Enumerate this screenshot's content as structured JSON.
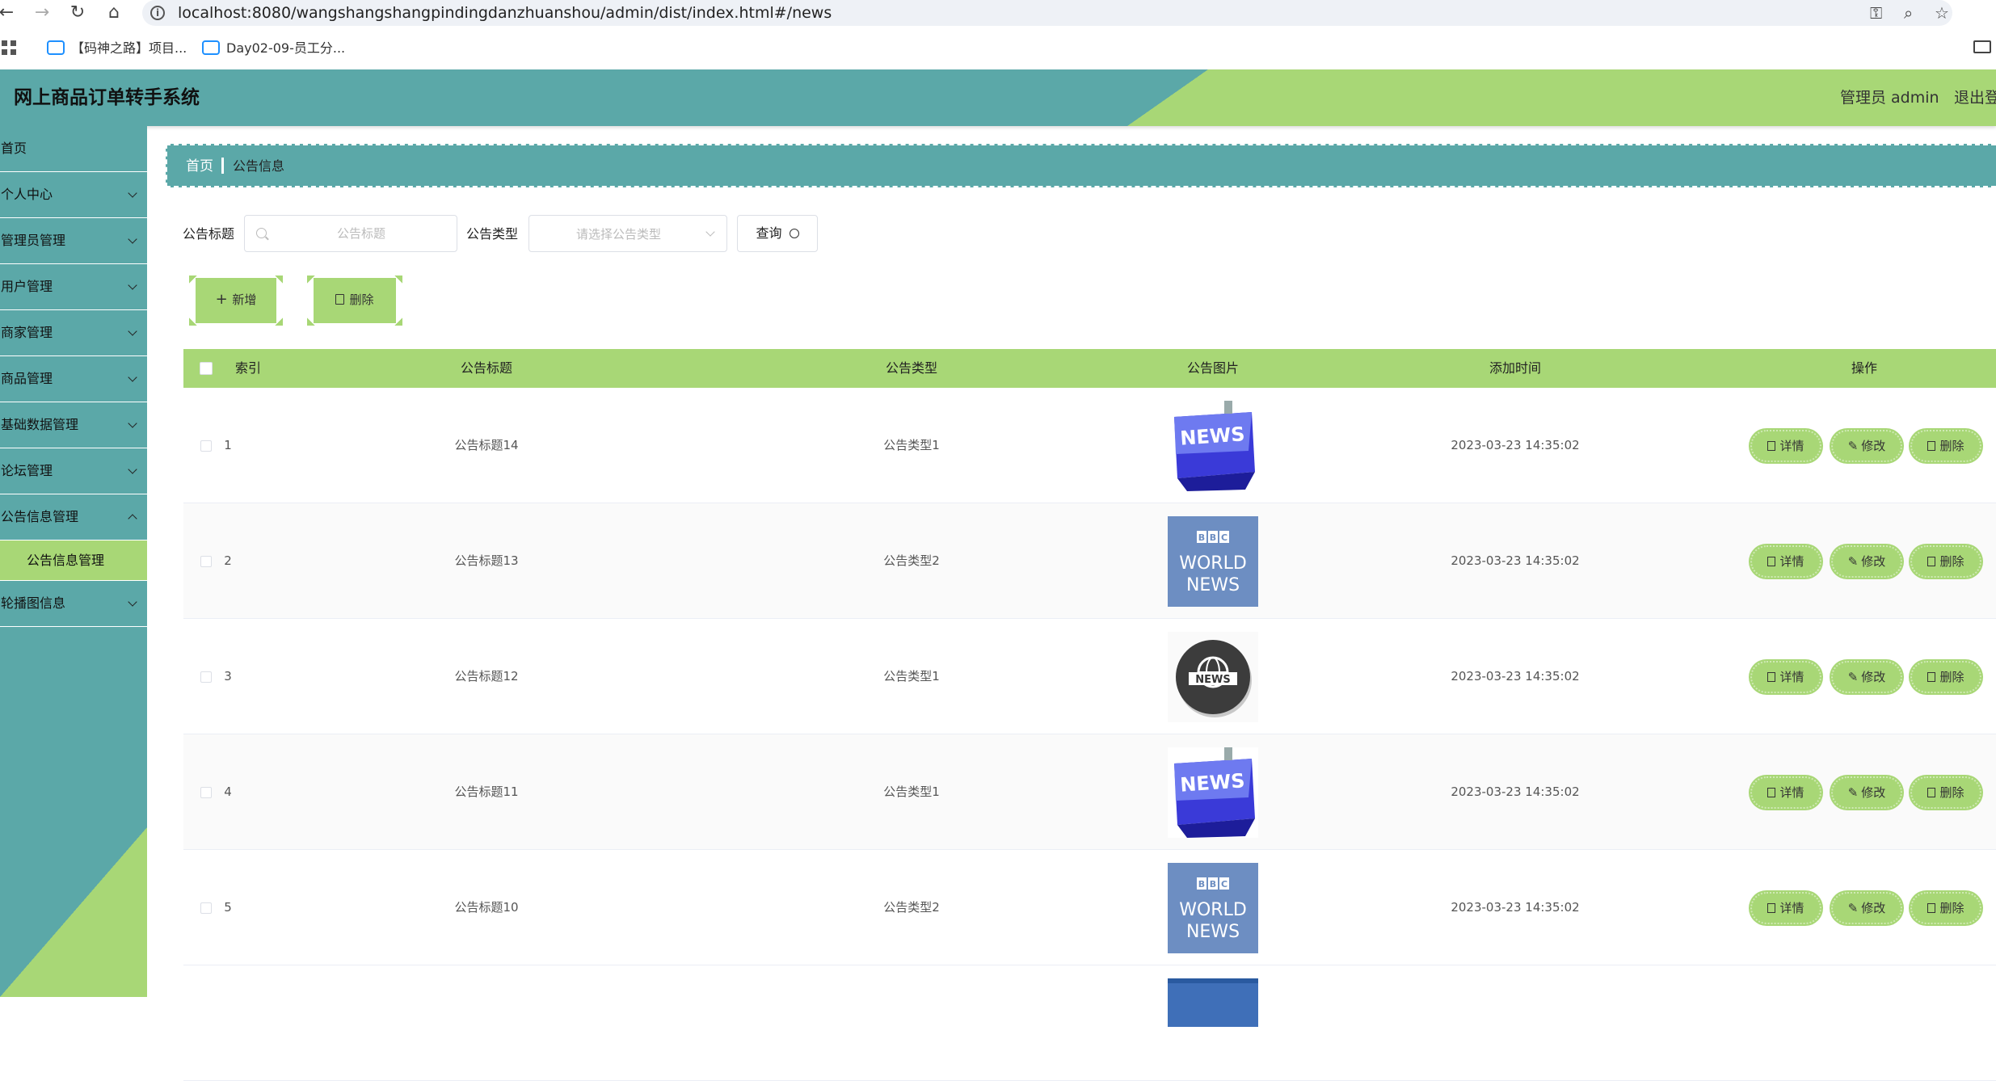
{
  "browser": {
    "url": "localhost:8080/wangshangshangpindingdanzhuanshou/admin/dist/index.html#/news",
    "bookmarks": [
      "【码神之路】项目...",
      "Day02-09-员工分..."
    ]
  },
  "header": {
    "title": "网上商品订单转手系统",
    "user": "管理员 admin",
    "logout": "退出登"
  },
  "sidebar": {
    "items": [
      {
        "label": "首页"
      },
      {
        "label": "个人中心"
      },
      {
        "label": "管理员管理"
      },
      {
        "label": "用户管理"
      },
      {
        "label": "商家管理"
      },
      {
        "label": "商品管理"
      },
      {
        "label": "基础数据管理"
      },
      {
        "label": "论坛管理"
      },
      {
        "label": "公告信息管理"
      },
      {
        "label": "公告信息管理"
      },
      {
        "label": "轮播图信息"
      }
    ]
  },
  "breadcrumb": {
    "home": "首页",
    "current": "公告信息"
  },
  "search": {
    "title_label": "公告标题",
    "title_placeholder": "公告标题",
    "type_label": "公告类型",
    "type_placeholder": "请选择公告类型",
    "query": "查询"
  },
  "actions": {
    "add": "新增",
    "delete": "删除"
  },
  "table": {
    "headers": [
      "索引",
      "公告标题",
      "公告类型",
      "公告图片",
      "添加时间",
      "操作"
    ],
    "rows": [
      {
        "index": "1",
        "title": "公告标题14",
        "type": "公告类型1",
        "image": "news-keyboard",
        "time": "2023-03-23 14:35:02"
      },
      {
        "index": "2",
        "title": "公告标题13",
        "type": "公告类型2",
        "image": "bbc-world-news",
        "time": "2023-03-23 14:35:02"
      },
      {
        "index": "3",
        "title": "公告标题12",
        "type": "公告类型1",
        "image": "news-globe",
        "time": "2023-03-23 14:35:02"
      },
      {
        "index": "4",
        "title": "公告标题11",
        "type": "公告类型1",
        "image": "news-keyboard",
        "time": "2023-03-23 14:35:02"
      },
      {
        "index": "5",
        "title": "公告标题10",
        "type": "公告类型2",
        "image": "bbc-world-news",
        "time": "2023-03-23 14:35:02"
      }
    ],
    "ops": {
      "detail": "详情",
      "edit": "修改",
      "delete": "删除"
    }
  },
  "colors": {
    "teal": "#5ba8a8",
    "green": "#a8d776"
  }
}
